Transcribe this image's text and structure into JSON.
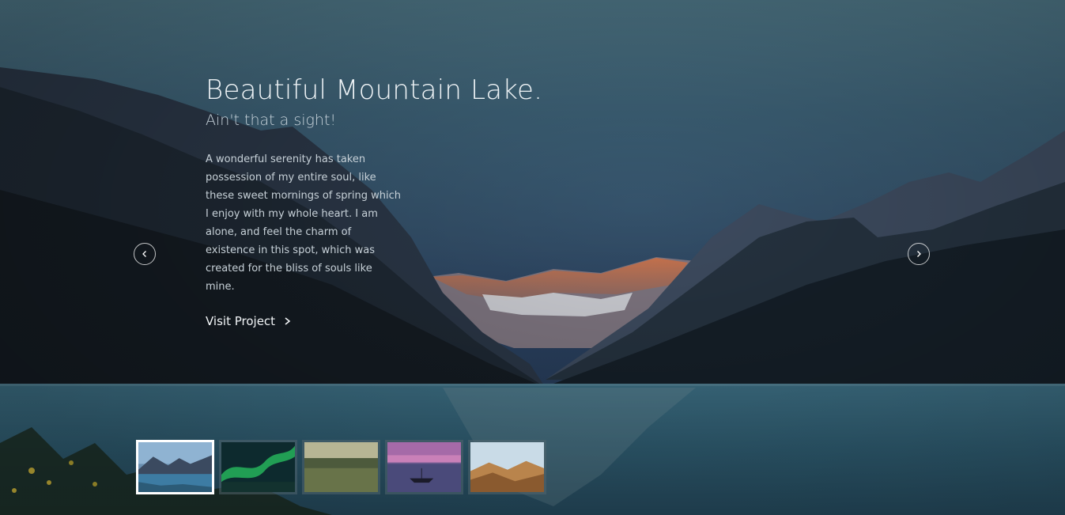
{
  "slide": {
    "title": "Beautiful Mountain Lake.",
    "subtitle": "Ain't that a sight!",
    "description": "A wonderful serenity has taken possession of my entire soul, like these sweet mornings of spring which I enjoy with my whole heart. I am alone, and feel the charm of existence in this spot, which was created for the bliss of souls like mine.",
    "cta_label": "Visit Project"
  },
  "navigation": {
    "prev_icon": "chevron-left-icon",
    "next_icon": "chevron-right-icon"
  },
  "thumbnails": [
    {
      "subject": "mountain lake",
      "active": true
    },
    {
      "subject": "northern lights",
      "active": false
    },
    {
      "subject": "green field",
      "active": false
    },
    {
      "subject": "boat at sunset",
      "active": false
    },
    {
      "subject": "desert dunes",
      "active": false
    }
  ],
  "colors": {
    "text": "#eef3f6",
    "active_thumb_border": "#ffffff",
    "sky": "#3b5e73"
  }
}
